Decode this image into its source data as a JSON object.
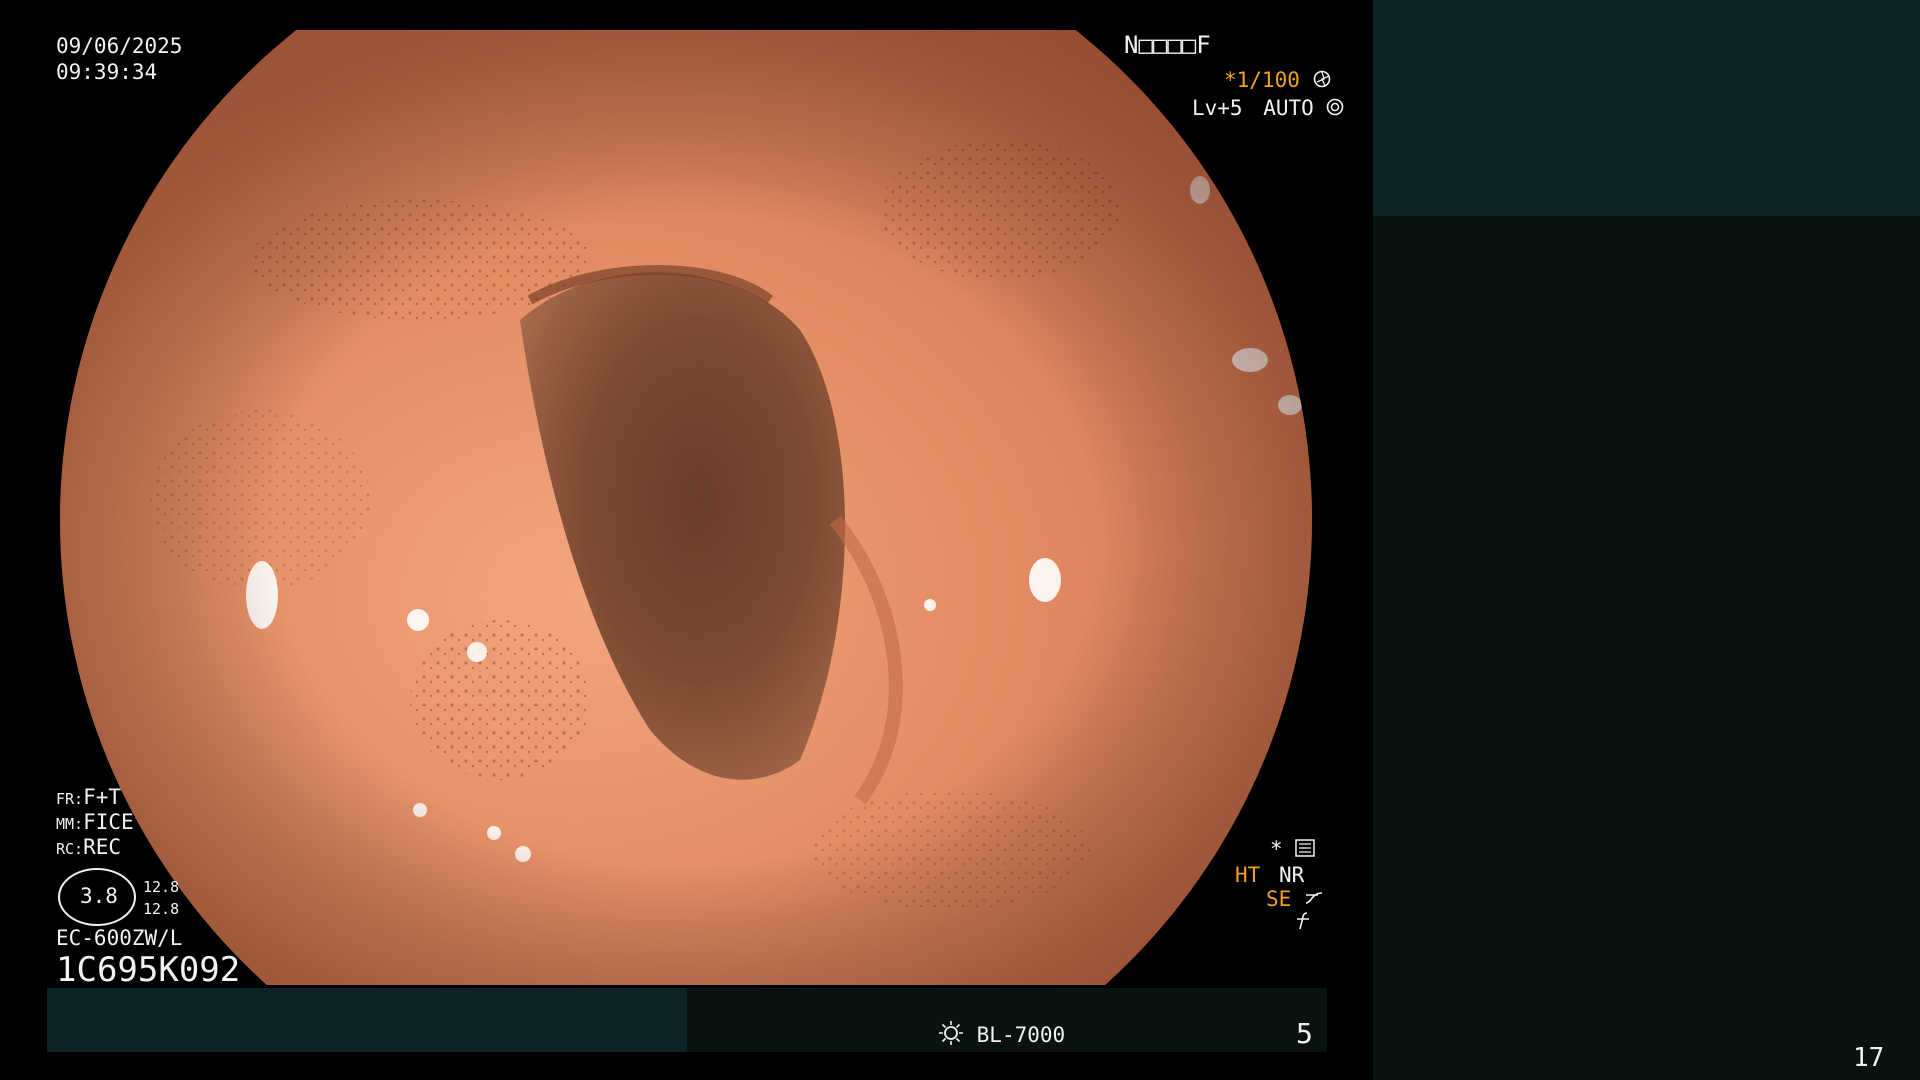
{
  "overlay": {
    "date": "09/06/2025",
    "time": "09:39:34",
    "patient_code": "N□□□□F",
    "shutter": "*1/100",
    "level": "Lv+5",
    "exposure": "AUTO",
    "fr_label": "FR:",
    "fr_value": "F+T",
    "mm_label": "MM:",
    "mm_value": "FICE",
    "rc_label": "RC:",
    "rc_value": "REC",
    "zoom_value": "3.8",
    "zoom_a": "12.8",
    "zoom_b": "12.8",
    "scope_model": "EC-600ZW/L",
    "scope_serial": "1C695K092",
    "marker_star": "*",
    "ht": "HT",
    "nr": "NR",
    "se": "SE",
    "light_source": "BL-7000",
    "channel": "5",
    "slide_number": "17"
  },
  "colors": {
    "tissue": "#e08a62",
    "panel_dark": "#071211",
    "panel_teal": "#0c2224",
    "accent_orange": "#f0a21c"
  },
  "icons": [
    "shutter-icon",
    "auto-exposure-icon",
    "settings-icon",
    "lamp-icon",
    "se-curve-icon",
    "f-icon"
  ]
}
